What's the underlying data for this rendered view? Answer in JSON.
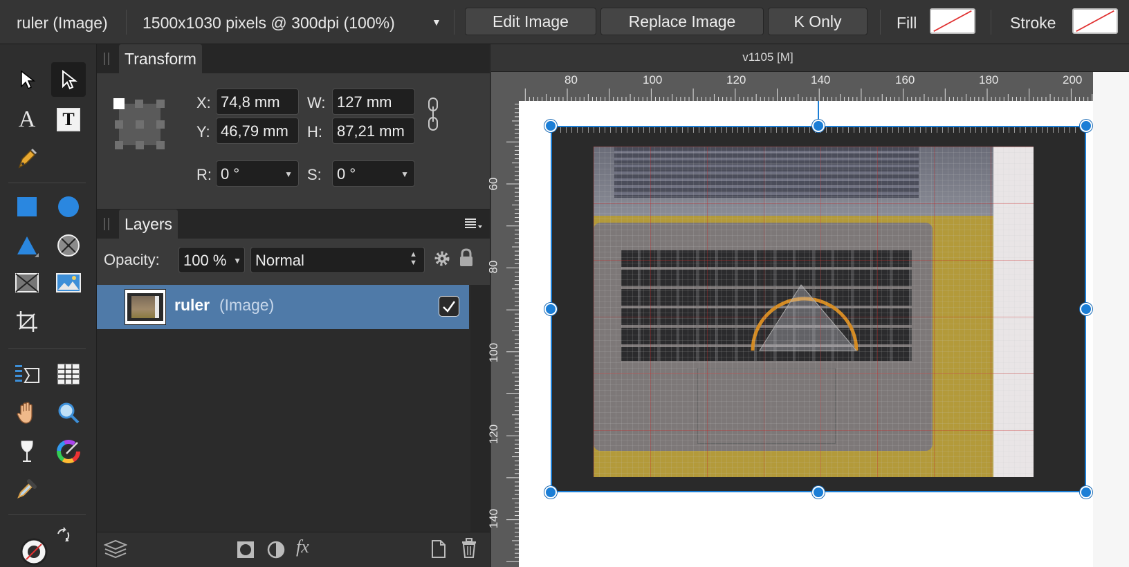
{
  "toolbar": {
    "selection": "ruler (Image)",
    "image_info": "1500x1030 pixels @ 300dpi (100%)",
    "edit_image": "Edit Image",
    "replace_image": "Replace Image",
    "k_only": "K Only",
    "fill_label": "Fill",
    "stroke_label": "Stroke"
  },
  "transform": {
    "tab": "Transform",
    "x_label": "X:",
    "x_value": "74,8 mm",
    "y_label": "Y:",
    "y_value": "46,79 mm",
    "w_label": "W:",
    "w_value": "127 mm",
    "h_label": "H:",
    "h_value": "87,21 mm",
    "r_label": "R:",
    "r_value": "0 °",
    "s_label": "S:",
    "s_value": "0 °"
  },
  "layers": {
    "tab": "Layers",
    "opacity_label": "Opacity:",
    "opacity_value": "100 %",
    "blend_mode": "Normal",
    "items": [
      {
        "name": "ruler",
        "type": "(Image)",
        "visible": true
      }
    ]
  },
  "view": {
    "title": "v1105  [M]",
    "ruler_unit": "mm",
    "h_ticks": [
      "80",
      "100",
      "120",
      "140",
      "160",
      "180",
      "200"
    ],
    "v_ticks": [
      "60",
      "80",
      "100",
      "120",
      "140"
    ]
  },
  "colors": {
    "accent": "#1b7ed6",
    "layer_selected": "#4f7aa8",
    "swatch_none": "#e03030"
  }
}
